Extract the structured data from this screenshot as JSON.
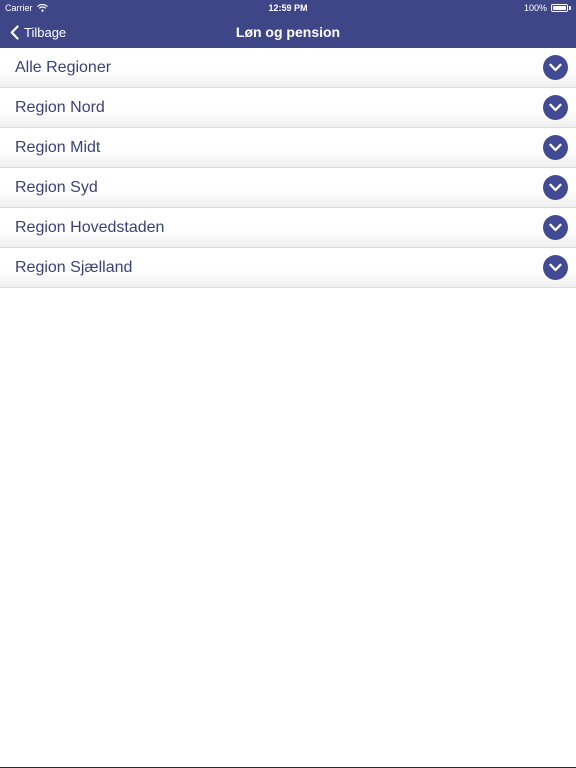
{
  "status_bar": {
    "carrier": "Carrier",
    "time": "12:59 PM",
    "battery": "100%",
    "battery_level": 1.0
  },
  "nav": {
    "back_label": "Tilbage",
    "title": "Løn og pension"
  },
  "regions": [
    {
      "label": "Alle Regioner"
    },
    {
      "label": "Region Nord"
    },
    {
      "label": "Region Midt"
    },
    {
      "label": "Region Syd"
    },
    {
      "label": "Region Hovedstaden"
    },
    {
      "label": "Region Sjælland"
    }
  ],
  "icons": {
    "back": "chevron-left-icon",
    "expand": "chevron-down-icon",
    "wifi": "wifi-icon",
    "battery": "battery-icon"
  },
  "colors": {
    "nav_bar": "#3f4688",
    "row_text": "#3b4178",
    "accent": "#424a94"
  }
}
